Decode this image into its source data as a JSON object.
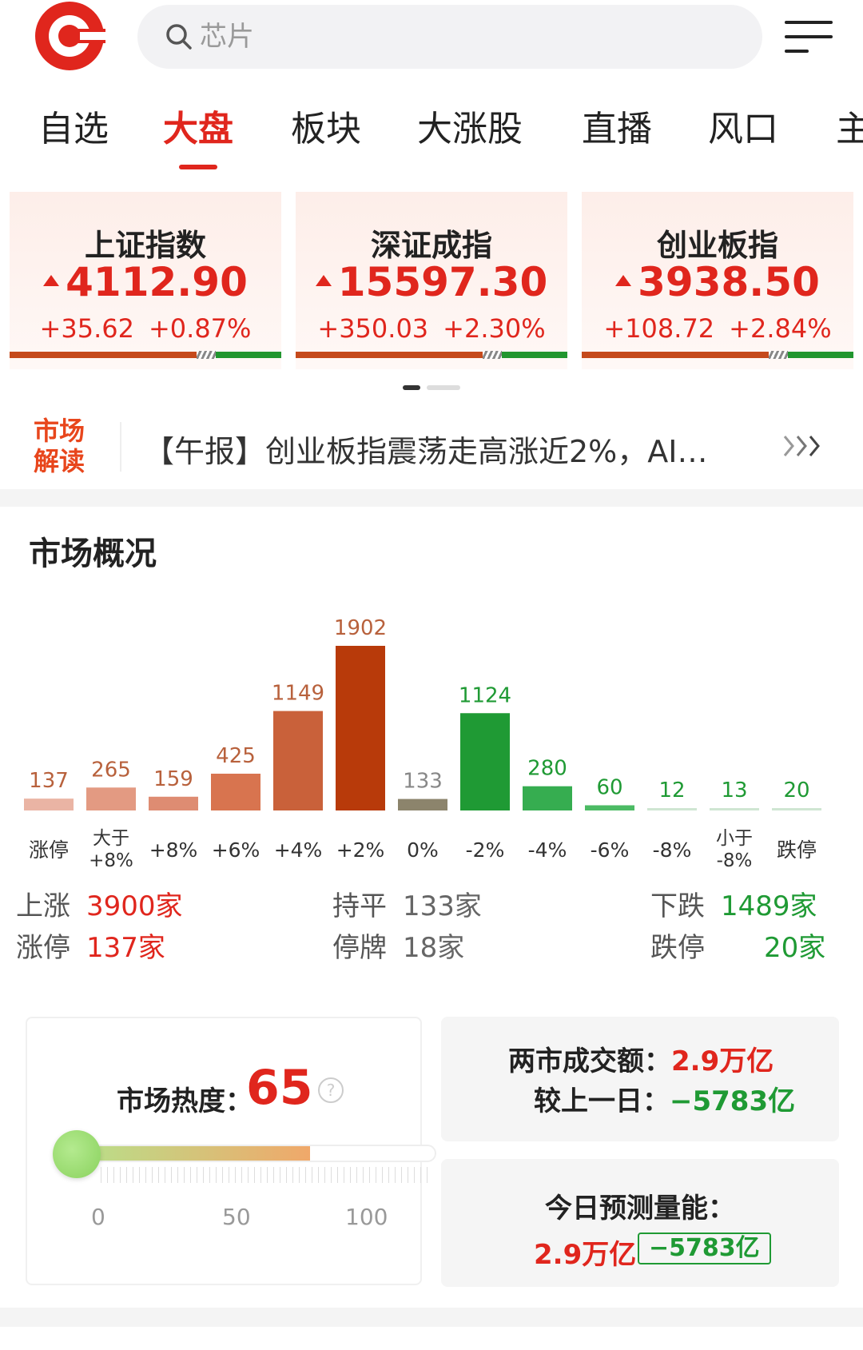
{
  "header": {
    "search_placeholder": "芯片"
  },
  "tabs": [
    {
      "label": "自选"
    },
    {
      "label": "大盘",
      "active": true
    },
    {
      "label": "板块"
    },
    {
      "label": "大涨股"
    },
    {
      "label": "直播"
    },
    {
      "label": "风口"
    },
    {
      "label": "主"
    }
  ],
  "indices": [
    {
      "name": "上证指数",
      "price": "4112.90",
      "change": "+35.62",
      "pct": "+0.87%"
    },
    {
      "name": "深证成指",
      "price": "15597.30",
      "change": "+350.03",
      "pct": "+2.30%"
    },
    {
      "name": "创业板指",
      "price": "3938.50",
      "change": "+108.72",
      "pct": "+2.84%"
    }
  ],
  "interp": {
    "tag_line1": "市场",
    "tag_line2": "解读",
    "text": "【午报】创业板指震荡走高涨近2%，AI…"
  },
  "overview": {
    "title": "市场概况"
  },
  "chart_data": {
    "type": "bar",
    "categories": [
      "涨停",
      "大于\n+8%",
      "+8%",
      "+6%",
      "+4%",
      "+2%",
      "0%",
      "-2%",
      "-4%",
      "-6%",
      "-8%",
      "小于\n-8%",
      "跌停"
    ],
    "values": [
      137,
      265,
      159,
      425,
      1149,
      1902,
      133,
      1124,
      280,
      60,
      12,
      13,
      20
    ],
    "colors": [
      "#eab4a4",
      "#e39a82",
      "#de8c72",
      "#d8744f",
      "#c9613a",
      "#b83a0a",
      "#8c846c",
      "#1f9a34",
      "#36ad50",
      "#4cbb64",
      "#cfe6d2",
      "#cfe6d2",
      "#cfe6d2"
    ],
    "label_colors": [
      "#b8613c",
      "#b8613c",
      "#b8613c",
      "#b8613c",
      "#b8613c",
      "#b8613c",
      "#888888",
      "#1f9a34",
      "#1f9a34",
      "#1f9a34",
      "#1f9a34",
      "#1f9a34",
      "#1f9a34"
    ],
    "ylim": [
      0,
      1902
    ]
  },
  "stats": {
    "up_label": "上涨",
    "up_value": "3900家",
    "flat_label": "持平",
    "flat_value": "133家",
    "down_label": "下跌",
    "down_value": "1489家",
    "limit_up_label": "涨停",
    "limit_up_value": "137家",
    "halt_label": "停牌",
    "halt_value": "18家",
    "limit_down_label": "跌停",
    "limit_down_value": "20家"
  },
  "heat": {
    "label": "市场热度：",
    "value": "65",
    "level": 65,
    "scale_min": "0",
    "scale_mid": "50",
    "scale_max": "100"
  },
  "turnover": {
    "label": "两市成交额：",
    "value": "2.9万亿",
    "compare_label": "较上一日：",
    "compare_value": "−5783亿"
  },
  "forecast": {
    "label": "今日预测量能：",
    "value": "2.9万亿",
    "diff": "−5783亿"
  }
}
